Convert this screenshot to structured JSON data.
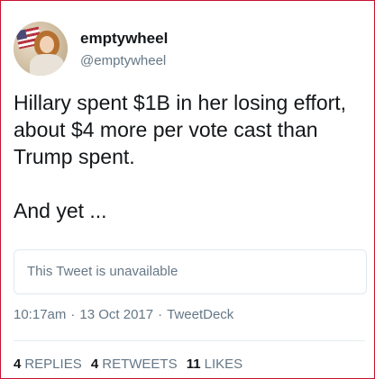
{
  "user": {
    "display_name": "emptywheel",
    "handle": "@emptywheel",
    "avatar_icon": "profile-photo-icon"
  },
  "tweet": {
    "text": "Hillary spent $1B in her losing effort, about $4 more per vote cast than Trump spent.\n\nAnd yet ..."
  },
  "quoted_tweet": {
    "text": "This Tweet is unavailable"
  },
  "meta": {
    "time": "10:17am",
    "separator": "·",
    "date": "13 Oct 2017",
    "source": "TweetDeck"
  },
  "stats": {
    "replies_count": "4",
    "replies_label": "REPLIES",
    "retweets_count": "4",
    "retweets_label": "RETWEETS",
    "likes_count": "11",
    "likes_label": "LIKES"
  },
  "colors": {
    "text_primary": "#14171a",
    "text_secondary": "#657786",
    "border_accent": "#c8102e",
    "quote_border": "#e1e8ed"
  }
}
